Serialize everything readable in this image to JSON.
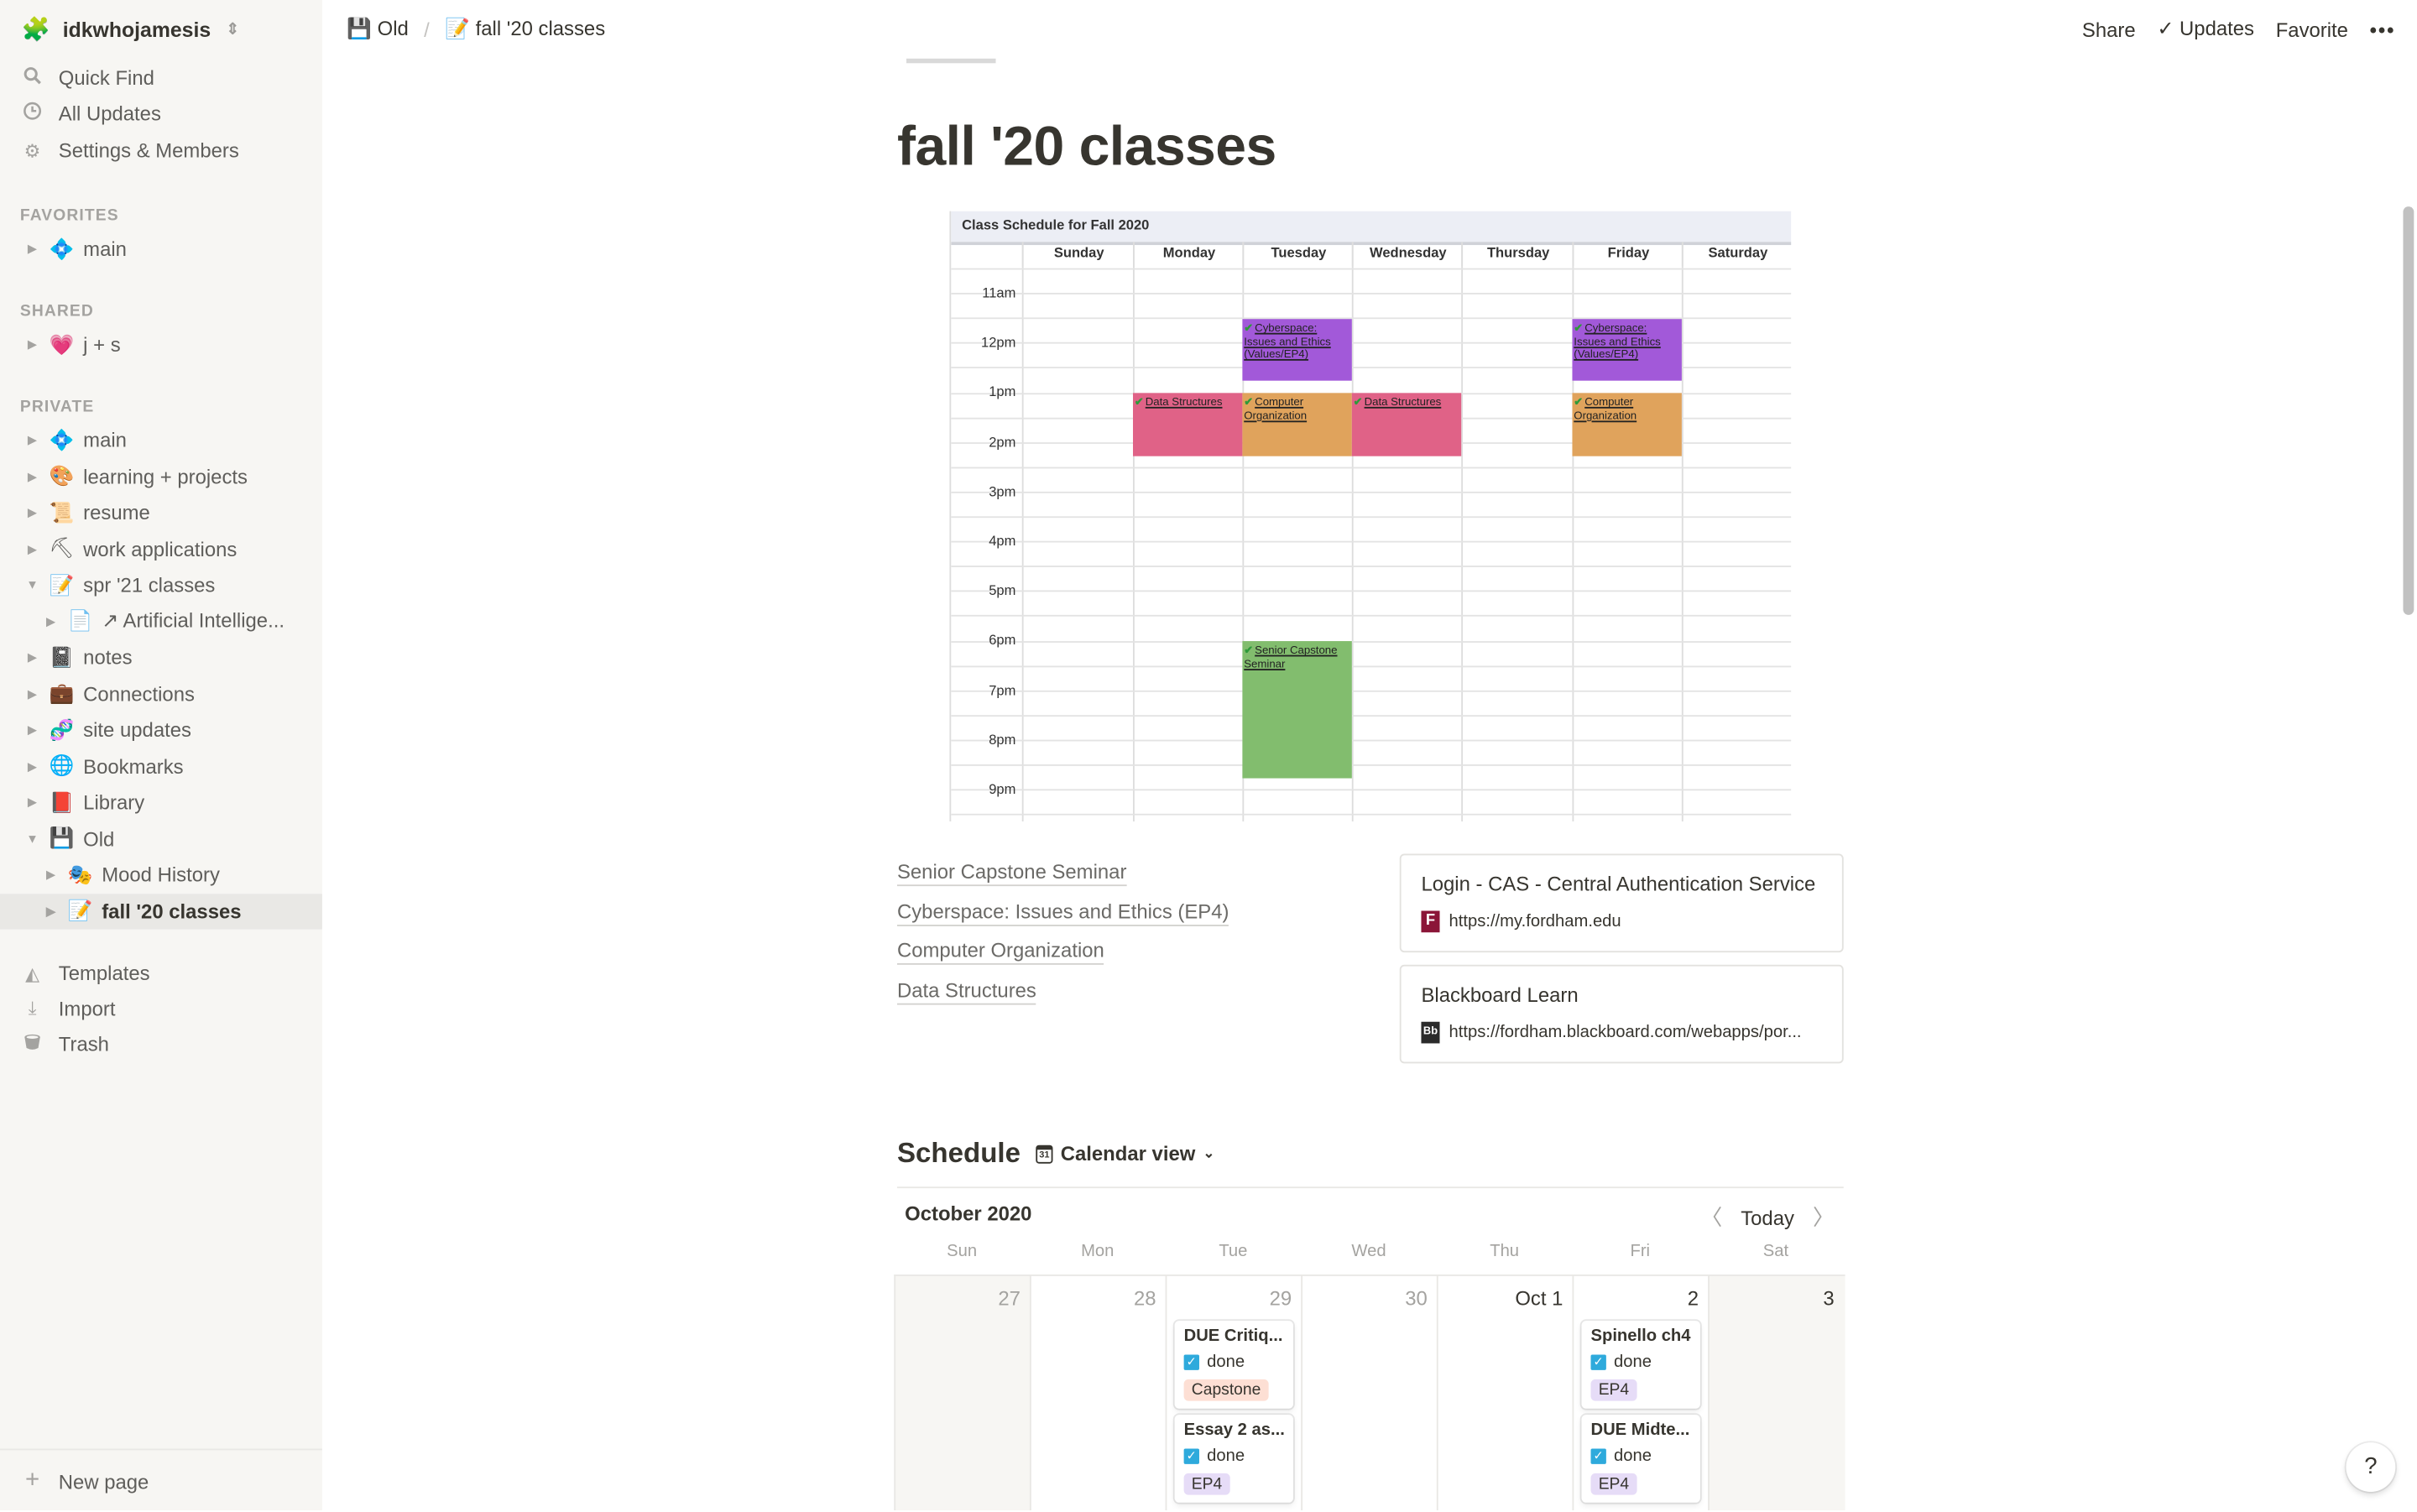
{
  "workspace": {
    "name": "idkwhojamesis",
    "icon": "🧩"
  },
  "sidebar": {
    "nav": [
      {
        "label": "Quick Find",
        "icon": "search-icon"
      },
      {
        "label": "All Updates",
        "icon": "clock-icon"
      },
      {
        "label": "Settings & Members",
        "icon": "gear-icon"
      }
    ],
    "sections": {
      "favorites": "FAVORITES",
      "shared": "SHARED",
      "private": "PRIVATE"
    },
    "favorites": [
      {
        "label": "main",
        "emoji": "💠"
      }
    ],
    "shared": [
      {
        "label": "j + s",
        "emoji": "💗"
      }
    ],
    "private": [
      {
        "label": "main",
        "emoji": "💠",
        "expanded": false
      },
      {
        "label": "learning + projects",
        "emoji": "🎨",
        "expanded": false
      },
      {
        "label": "resume",
        "emoji": "📜",
        "expanded": false
      },
      {
        "label": "work applications",
        "emoji": "⛏",
        "expanded": false
      },
      {
        "label": "spr '21 classes",
        "emoji": "📝",
        "expanded": true
      },
      {
        "label": "↗ Artificial Intellige...",
        "emoji": "📄",
        "expanded": false,
        "child": true
      },
      {
        "label": "notes",
        "emoji": "📓",
        "expanded": false
      },
      {
        "label": "Connections",
        "emoji": "💼",
        "expanded": false
      },
      {
        "label": "site updates",
        "emoji": "🧬",
        "expanded": false
      },
      {
        "label": "Bookmarks",
        "emoji": "🌐",
        "expanded": false
      },
      {
        "label": "Library",
        "emoji": "📕",
        "expanded": false
      },
      {
        "label": "Old",
        "emoji": "💾",
        "expanded": true
      },
      {
        "label": "Mood History",
        "emoji": "🎭",
        "expanded": false,
        "child": true
      },
      {
        "label": "fall '20 classes",
        "emoji": "📝",
        "expanded": false,
        "child": true,
        "active": true
      }
    ],
    "tools": [
      {
        "label": "Templates",
        "icon": "templates-icon"
      },
      {
        "label": "Import",
        "icon": "import-icon"
      },
      {
        "label": "Trash",
        "icon": "trash-icon"
      }
    ],
    "new_page": "New page"
  },
  "topbar": {
    "breadcrumb": [
      {
        "label": "Old",
        "emoji": "💾"
      },
      {
        "label": "fall '20 classes",
        "emoji": "📝"
      }
    ],
    "share": "Share",
    "updates": "Updates",
    "favorite": "Favorite",
    "more": "•••"
  },
  "page": {
    "title": "fall '20 classes",
    "class_schedule": {
      "title": "Class Schedule for Fall 2020",
      "days": [
        "Sunday",
        "Monday",
        "Tuesday",
        "Wednesday",
        "Thursday",
        "Friday",
        "Saturday"
      ],
      "hours": [
        "11am",
        "12pm",
        "1pm",
        "2pm",
        "3pm",
        "4pm",
        "5pm",
        "6pm",
        "7pm",
        "8pm",
        "9pm"
      ],
      "events": [
        {
          "title": "Cyberspace: Issues and Ethics (Values/EP4)",
          "day": 2,
          "start": 11.5,
          "end": 12.75,
          "color": "#a259d9"
        },
        {
          "title": "Cyberspace: Issues and Ethics (Values/EP4)",
          "day": 5,
          "start": 11.5,
          "end": 12.75,
          "color": "#a259d9"
        },
        {
          "title": "Data Structures",
          "day": 1,
          "start": 13,
          "end": 14.25,
          "color": "#e06287"
        },
        {
          "title": "Computer Organization",
          "day": 2,
          "start": 13,
          "end": 14.25,
          "color": "#e0a35c"
        },
        {
          "title": "Data Structures",
          "day": 3,
          "start": 13,
          "end": 14.25,
          "color": "#e06287"
        },
        {
          "title": "Computer Organization",
          "day": 5,
          "start": 13,
          "end": 14.25,
          "color": "#e0a35c"
        },
        {
          "title": "Senior Capstone Seminar",
          "day": 2,
          "start": 18,
          "end": 20.75,
          "color": "#82bd6e"
        }
      ]
    },
    "links": [
      "Senior Capstone Seminar",
      "Cyberspace: Issues and Ethics (EP4)",
      "Computer Organization",
      "Data Structures"
    ],
    "bookmarks": [
      {
        "title": "Login - CAS - Central Authentication Service",
        "url": "https://my.fordham.edu",
        "favicon": "F",
        "favicon_color": "#8b1538"
      },
      {
        "title": "Blackboard Learn",
        "url": "https://fordham.blackboard.com/webapps/por...",
        "favicon": "Bb",
        "favicon_color": "#2b2b2b"
      }
    ],
    "schedule": {
      "heading": "Schedule",
      "view": "Calendar view",
      "month": "October 2020",
      "today": "Today",
      "dow": [
        "Sun",
        "Mon",
        "Tue",
        "Wed",
        "Thu",
        "Fri",
        "Sat"
      ],
      "days": [
        {
          "label": "27",
          "current": false,
          "weekend": true,
          "items": []
        },
        {
          "label": "28",
          "current": false,
          "weekend": false,
          "items": []
        },
        {
          "label": "29",
          "current": false,
          "weekend": false,
          "items": [
            {
              "title": "DUE Critiq...",
              "done": "done",
              "tag": "Capstone",
              "tag_color": "#fddfd4"
            },
            {
              "title": "Essay 2 as...",
              "done": "done",
              "tag": "EP4",
              "tag_color": "#e6dcf7"
            }
          ]
        },
        {
          "label": "30",
          "current": false,
          "weekend": false,
          "items": []
        },
        {
          "label": "Oct 1",
          "current": true,
          "weekend": false,
          "items": []
        },
        {
          "label": "2",
          "current": true,
          "weekend": false,
          "items": [
            {
              "title": "Spinello ch4",
              "done": "done",
              "tag": "EP4",
              "tag_color": "#e6dcf7"
            },
            {
              "title": "DUE Midte...",
              "done": "done",
              "tag": "EP4",
              "tag_color": "#e6dcf7"
            }
          ]
        },
        {
          "label": "3",
          "current": true,
          "weekend": true,
          "items": []
        }
      ]
    }
  },
  "help": "?"
}
